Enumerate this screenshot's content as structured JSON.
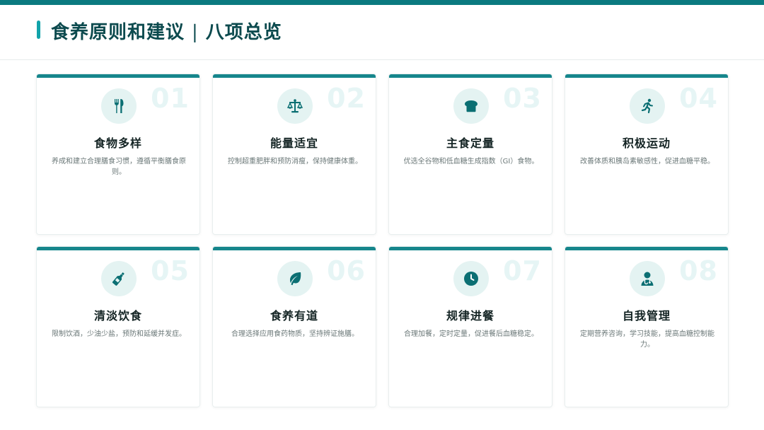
{
  "header": {
    "title_main": "食养原则和建议",
    "title_sep": "|",
    "title_sub": "八项总览"
  },
  "colors": {
    "accent": "#0b7a80",
    "icon_bg": "#e4f3f2",
    "number": "#e6f5f5"
  },
  "cards": [
    {
      "number": "01",
      "icon": "fork-knife-icon",
      "title": "食物多样",
      "desc": "养成和建立合理膳食习惯，遵循平衡膳食原则。"
    },
    {
      "number": "02",
      "icon": "balance-scale-icon",
      "title": "能量适宜",
      "desc": "控制超重肥胖和预防消瘦，保持健康体重。"
    },
    {
      "number": "03",
      "icon": "bread-icon",
      "title": "主食定量",
      "desc": "优选全谷物和低血糖生成指数（GI）食物。"
    },
    {
      "number": "04",
      "icon": "running-icon",
      "title": "积极运动",
      "desc": "改善体质和胰岛素敏感性，促进血糖平稳。"
    },
    {
      "number": "05",
      "icon": "bottle-icon",
      "title": "清淡饮食",
      "desc": "限制饮酒，少油少盐，预防和延缓并发症。"
    },
    {
      "number": "06",
      "icon": "leaf-icon",
      "title": "食养有道",
      "desc": "合理选择应用食药物质，坚持辨证施膳。"
    },
    {
      "number": "07",
      "icon": "clock-icon",
      "title": "规律进餐",
      "desc": "合理加餐，定时定量，促进餐后血糖稳定。"
    },
    {
      "number": "08",
      "icon": "doctor-icon",
      "title": "自我管理",
      "desc": "定期营养咨询，学习技能，提高血糖控制能力。"
    }
  ]
}
